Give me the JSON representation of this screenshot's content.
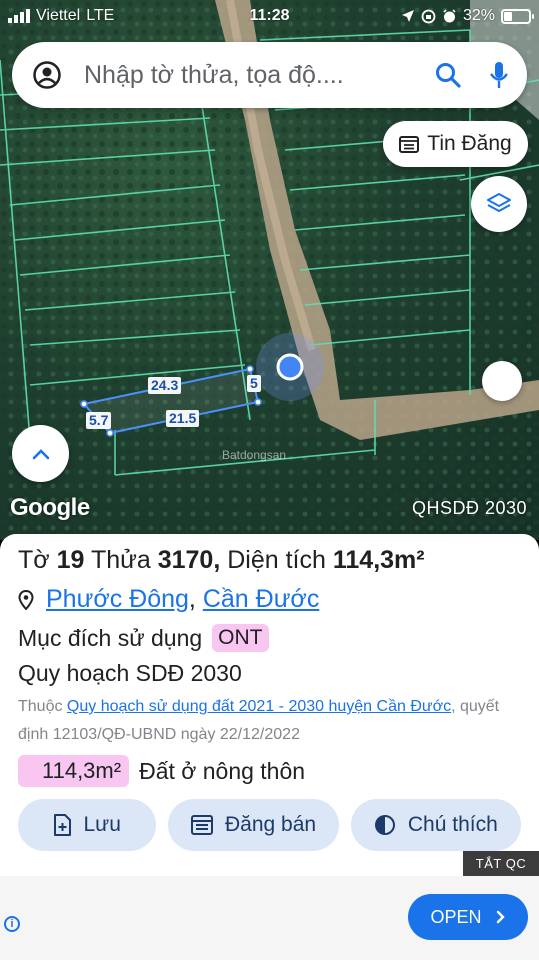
{
  "status_bar": {
    "carrier": "Viettel",
    "network": "LTE",
    "time": "11:28",
    "battery": "32%",
    "battery_level": 0.32
  },
  "search": {
    "placeholder": "Nhập tờ thửa, tọa độ...."
  },
  "map": {
    "tin_dang_label": "Tin Đăng",
    "google_label": "Google",
    "plan_label": "QHSDĐ 2030",
    "watermark": "Batdongsan",
    "dimensions": {
      "top": "24.3",
      "right": "5",
      "left": "5.7",
      "bottom": "21.5"
    }
  },
  "parcel": {
    "to_label": "Tờ",
    "to_number": "19",
    "thua_label": "Thửa",
    "thua_number": "3170,",
    "area_label": "Diện tích",
    "area": "114,3m²",
    "ward": "Phước Đông",
    "district": "Cần Đước",
    "purpose_label": "Mục đích sử dụng",
    "purpose_code": "ONT",
    "plan_title": "Quy hoạch SDĐ 2030",
    "belongs_prefix": "Thuộc",
    "plan_link": "Quy hoạch sử dụng đất 2021 - 2030 huyện Cần Đước",
    "decision": ", quyết định 12103/QĐ-UBND ngày 22/12/2022",
    "plan_area": "114,3m²",
    "land_type": "Đất ở nông thôn"
  },
  "actions": {
    "save": "Lưu",
    "post": "Đăng bán",
    "legend": "Chú thích"
  },
  "ad": {
    "hide_label": "TẮT QC",
    "open_label": "OPEN"
  },
  "colors": {
    "accent": "#1a73e8",
    "badge": "#f8c6f0",
    "action_bg": "#dbe6f6",
    "parcel_line": "#5ee0b0"
  }
}
